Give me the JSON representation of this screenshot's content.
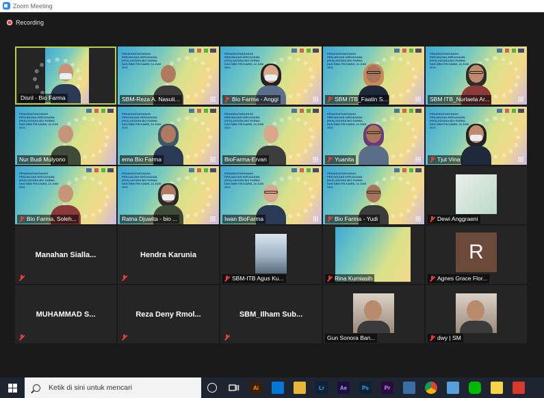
{
  "window": {
    "title": "Zoom Meeting"
  },
  "recording": {
    "label": "Recording"
  },
  "slide": {
    "text": "PENANDATANGANAN PERJANJIAN KERJASAMA (PKS) ANTARA BIO FARMA DAN SBM ITB KAMIS, 24 JUNI 2021"
  },
  "participants": [
    {
      "name": "Disril - Bio Farma",
      "kind": "video-plain",
      "muted": false,
      "active": true
    },
    {
      "name": "SBM-Reza A. Nasuti...",
      "kind": "video",
      "muted": false
    },
    {
      "name": "Bio Farma - Anggi",
      "kind": "video",
      "muted": true
    },
    {
      "name": "SBM ITB_Faatin S...",
      "kind": "video",
      "muted": true
    },
    {
      "name": "SBM ITB_Nurlaela Ar...",
      "kind": "video",
      "muted": false
    },
    {
      "name": "Nur Budi Mulyono",
      "kind": "video",
      "muted": false
    },
    {
      "name": "ema Bio Farma",
      "kind": "video",
      "muted": false
    },
    {
      "name": "BioFarma-Ervan",
      "kind": "video",
      "muted": false
    },
    {
      "name": "Yuanita",
      "kind": "video",
      "muted": true
    },
    {
      "name": "Tjut Vina",
      "kind": "video",
      "muted": true
    },
    {
      "name": "Bio Farma, Soleh...",
      "kind": "video",
      "muted": true
    },
    {
      "name": "Ratna Djuwita - bio ...",
      "kind": "video",
      "muted": false
    },
    {
      "name": "Iwan BioFarma",
      "kind": "video",
      "muted": false
    },
    {
      "name": "Bio Farma - Yudi",
      "kind": "video",
      "muted": true
    },
    {
      "name": "Dewi Anggraeni",
      "kind": "photo",
      "muted": true
    },
    {
      "name": "Manahan  Sialla...",
      "kind": "name-only",
      "muted": true
    },
    {
      "name": "Hendra Karunia",
      "kind": "name-only",
      "muted": true
    },
    {
      "name": "SBM-ITB Agus Ku...",
      "kind": "photo",
      "muted": true
    },
    {
      "name": "Rina Kurniasih",
      "kind": "photo",
      "muted": true
    },
    {
      "name": "Agnes Grace Flor...",
      "kind": "avatar",
      "avatar_letter": "R",
      "muted": true
    },
    {
      "name": "MUHAMMAD  S...",
      "kind": "name-only",
      "muted": true
    },
    {
      "name": "Reza  Deny  Rmol...",
      "kind": "name-only",
      "muted": true
    },
    {
      "name": "SBM_Ilham  Sub...",
      "kind": "name-only",
      "muted": true
    },
    {
      "name": "Gun Sonora Ban...",
      "kind": "photo",
      "muted": false
    },
    {
      "name": "dwy | SM",
      "kind": "photo",
      "muted": true
    }
  ],
  "taskbar": {
    "search_placeholder": "Ketik di sini untuk mencari",
    "apps": [
      {
        "icon": "illustrator-icon",
        "label": "Ai",
        "color": "#3b1f05",
        "fg": "#ff9a00"
      },
      {
        "icon": "store-icon",
        "label": "",
        "color": "#0078d7",
        "fg": "#fff"
      },
      {
        "icon": "folder-icon",
        "label": "",
        "color": "#e8b73a",
        "fg": "#fff"
      },
      {
        "icon": "lightroom-icon",
        "label": "Lr",
        "color": "#0e2235",
        "fg": "#31a8ff"
      },
      {
        "icon": "after-effects-icon",
        "label": "Ae",
        "color": "#1f0d3f",
        "fg": "#a6a1ff"
      },
      {
        "icon": "photoshop-icon",
        "label": "Ps",
        "color": "#0e2235",
        "fg": "#31a8ff"
      },
      {
        "icon": "premiere-icon",
        "label": "Pr",
        "color": "#2a0b3d",
        "fg": "#d492ff"
      },
      {
        "icon": "network-icon",
        "label": "",
        "color": "#3a6fa6",
        "fg": "#fff"
      },
      {
        "icon": "chrome-icon",
        "label": "",
        "color": "#db4437",
        "fg": "#fff"
      },
      {
        "icon": "notepad-icon",
        "label": "",
        "color": "#5aa0d8",
        "fg": "#fff"
      },
      {
        "icon": "line-icon",
        "label": "",
        "color": "#00b900",
        "fg": "#fff"
      },
      {
        "icon": "sticky-notes-icon",
        "label": "",
        "color": "#f5d547",
        "fg": "#fff"
      },
      {
        "icon": "app-icon",
        "label": "",
        "color": "#d73a2a",
        "fg": "#fff"
      }
    ]
  }
}
